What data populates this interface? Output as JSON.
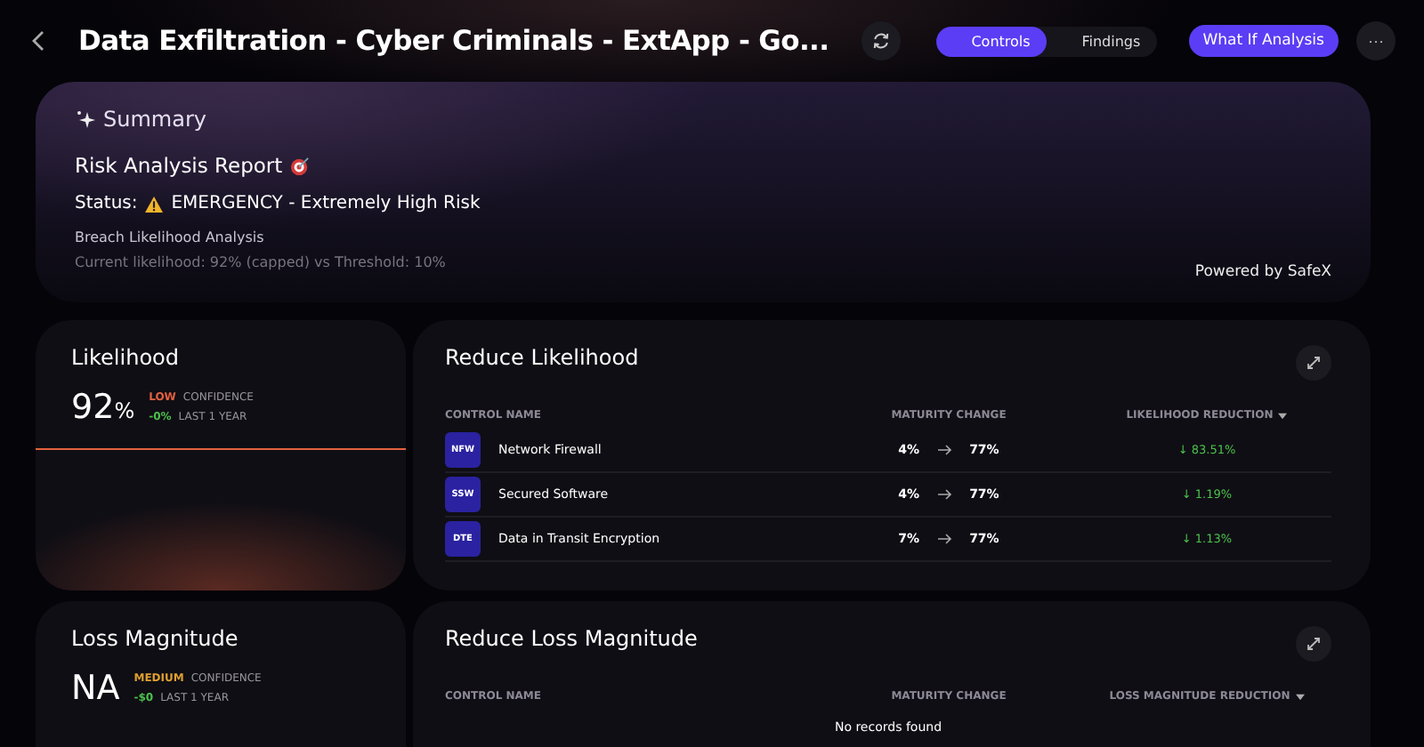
{
  "header": {
    "title": "Data Exfiltration - Cyber Criminals - ExtApp - Go...",
    "tabs": [
      {
        "label": "Controls",
        "selected": true
      },
      {
        "label": "Findings",
        "selected": false
      }
    ],
    "primary_button": "What If Analysis",
    "more_button": "···"
  },
  "summary": {
    "heading": "Summary",
    "report_title": "Risk Analysis Report",
    "status_label": "Status:",
    "status_text": "EMERGENCY - Extremely High Risk",
    "section_title": "Breach Likelihood Analysis",
    "detail": "Current likelihood: 92% (capped) vs Threshold: 10%",
    "powered_by": "Powered by SafeX"
  },
  "metrics": [
    {
      "title": "Likelihood",
      "value": "92",
      "unit": "%",
      "confidence": {
        "text": "LOW",
        "color": "#e4603f"
      },
      "confidence_label": "CONFIDENCE",
      "change": "-0%",
      "period": "LAST 1 YEAR",
      "trend": true
    },
    {
      "title": "Loss Magnitude",
      "value": "NA",
      "confidence": {
        "text": "MEDIUM",
        "color": "#e0a030"
      },
      "confidence_label": "CONFIDENCE",
      "change": "-$0",
      "period": "LAST 1 YEAR",
      "trend": false
    }
  ],
  "tables": [
    {
      "title": "Reduce Likelihood",
      "columns": [
        "CONTROL NAME",
        "MATURITY CHANGE",
        "LIKELIHOOD REDUCTION"
      ],
      "rows": [
        {
          "badge": "NFW",
          "name": "Network Firewall",
          "from": "4%",
          "to": "77%",
          "reduction": "↓ 83.51%"
        },
        {
          "badge": "SSW",
          "name": "Secured Software",
          "from": "4%",
          "to": "77%",
          "reduction": "↓ 1.19%"
        },
        {
          "badge": "DTE",
          "name": "Data in Transit Encryption",
          "from": "7%",
          "to": "77%",
          "reduction": "↓ 1.13%"
        }
      ]
    },
    {
      "title": "Reduce Loss Magnitude",
      "columns": [
        "CONTROL NAME",
        "MATURITY CHANGE",
        "LOSS MAGNITUDE REDUCTION"
      ],
      "empty_message": "No records found"
    }
  ]
}
